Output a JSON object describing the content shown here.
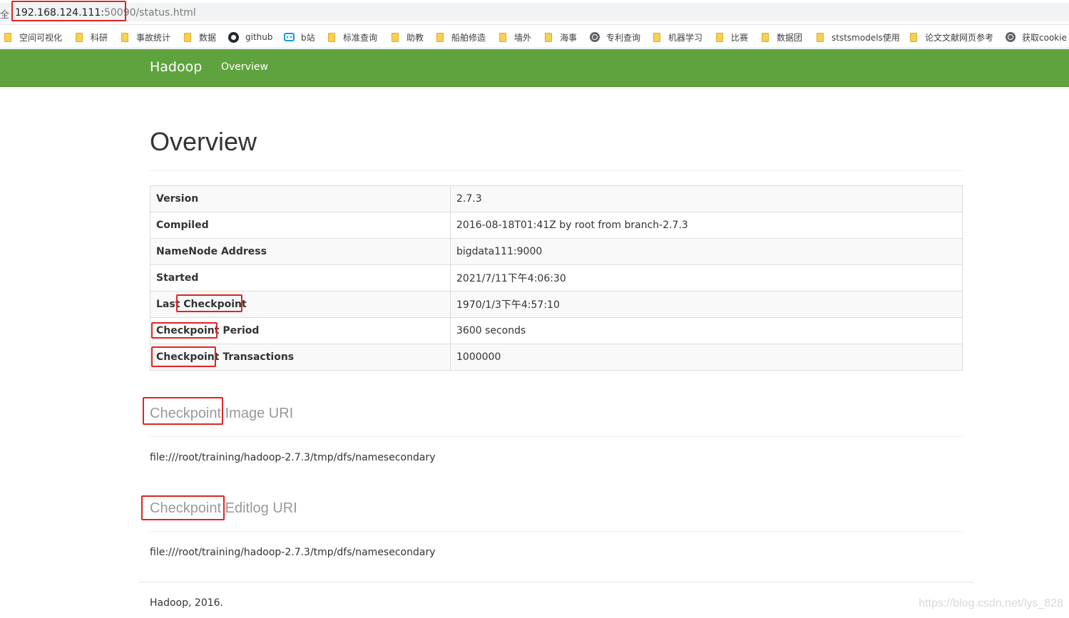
{
  "browser": {
    "address_bar": {
      "secure_glyph": "全",
      "host": "192.168.124.111:",
      "port": "50090",
      "path": "/status.html"
    },
    "bookmarks": [
      {
        "icon": "folder-icon",
        "label": "空间可视化"
      },
      {
        "icon": "folder-icon",
        "label": "科研"
      },
      {
        "icon": "folder-icon",
        "label": "事故统计"
      },
      {
        "icon": "folder-icon",
        "label": "数据"
      },
      {
        "icon": "github-icon",
        "label": "github"
      },
      {
        "icon": "bilibili-icon",
        "label": "b站"
      },
      {
        "icon": "folder-icon",
        "label": "标准查询"
      },
      {
        "icon": "folder-icon",
        "label": "助教"
      },
      {
        "icon": "folder-icon",
        "label": "船舶修造"
      },
      {
        "icon": "folder-icon",
        "label": "墙外"
      },
      {
        "icon": "folder-icon",
        "label": "海事"
      },
      {
        "icon": "globe-icon",
        "label": "专利查询"
      },
      {
        "icon": "folder-icon",
        "label": "机器学习"
      },
      {
        "icon": "folder-icon",
        "label": "比赛"
      },
      {
        "icon": "folder-icon",
        "label": "数据团"
      },
      {
        "icon": "folder-icon",
        "label": "ststsmodels使用"
      },
      {
        "icon": "folder-icon",
        "label": "论文文献网页参考"
      },
      {
        "icon": "globe-icon",
        "label": "获取cookie"
      }
    ]
  },
  "navbar": {
    "brand": "Hadoop",
    "links": [
      "Overview"
    ],
    "color": "#5fa33e"
  },
  "page": {
    "title": "Overview",
    "overview_rows": [
      {
        "key": "Version",
        "value": "2.7.3"
      },
      {
        "key": "Compiled",
        "value": "2016-08-18T01:41Z by root from branch-2.7.3"
      },
      {
        "key": "NameNode Address",
        "value": "bigdata111:9000"
      },
      {
        "key": "Started",
        "value": "2021/7/11下午4:06:30"
      },
      {
        "key": "Last Checkpoint",
        "value": "1970/1/3下午4:57:10"
      },
      {
        "key": "Checkpoint Period",
        "value": "3600 seconds"
      },
      {
        "key": "Checkpoint Transactions",
        "value": "1000000"
      }
    ],
    "checkpoint_image_uri": {
      "heading": "Checkpoint Image URI",
      "value": "file:///root/training/hadoop-2.7.3/tmp/dfs/namesecondary"
    },
    "checkpoint_editlog_uri": {
      "heading": "Checkpoint Editlog URI",
      "value": "file:///root/training/hadoop-2.7.3/tmp/dfs/namesecondary"
    },
    "footer": "Hadoop, 2016.",
    "watermark": "https://blog.csdn.net/lys_828"
  },
  "annotation_color": "#e02424"
}
